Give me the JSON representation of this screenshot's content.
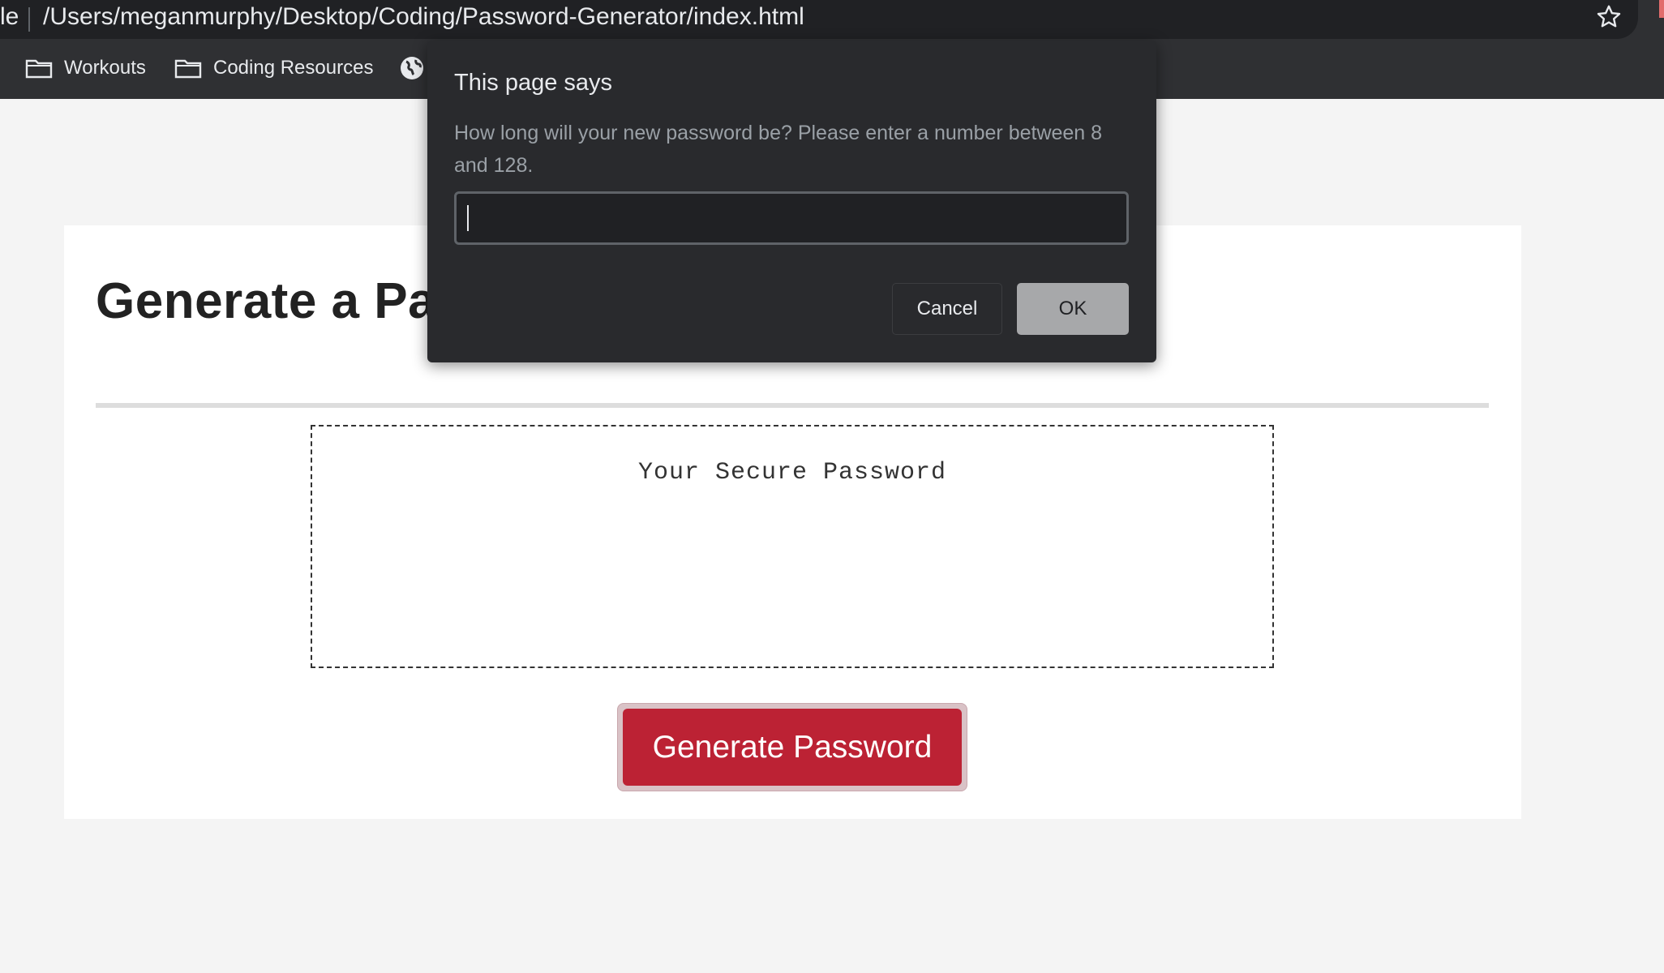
{
  "browser": {
    "url_prefix": "le",
    "url": "/Users/meganmurphy/Desktop/Coding/Password-Generator/index.html",
    "bookmarks": [
      {
        "label": "Workouts",
        "icon": "folder-icon"
      },
      {
        "label": "Coding Resources",
        "icon": "folder-icon"
      }
    ],
    "globe_icon": "globe-icon",
    "star_icon": "star-icon"
  },
  "page": {
    "title": "Generate a Pas",
    "password_placeholder": "Your Secure Password",
    "generate_button_label": "Generate Password",
    "accent_color": "#bc2234"
  },
  "dialog": {
    "title": "This page says",
    "message": "How long will your new password be? Please enter a number between 8 and 128.",
    "input_value": "",
    "cancel_label": "Cancel",
    "ok_label": "OK"
  }
}
